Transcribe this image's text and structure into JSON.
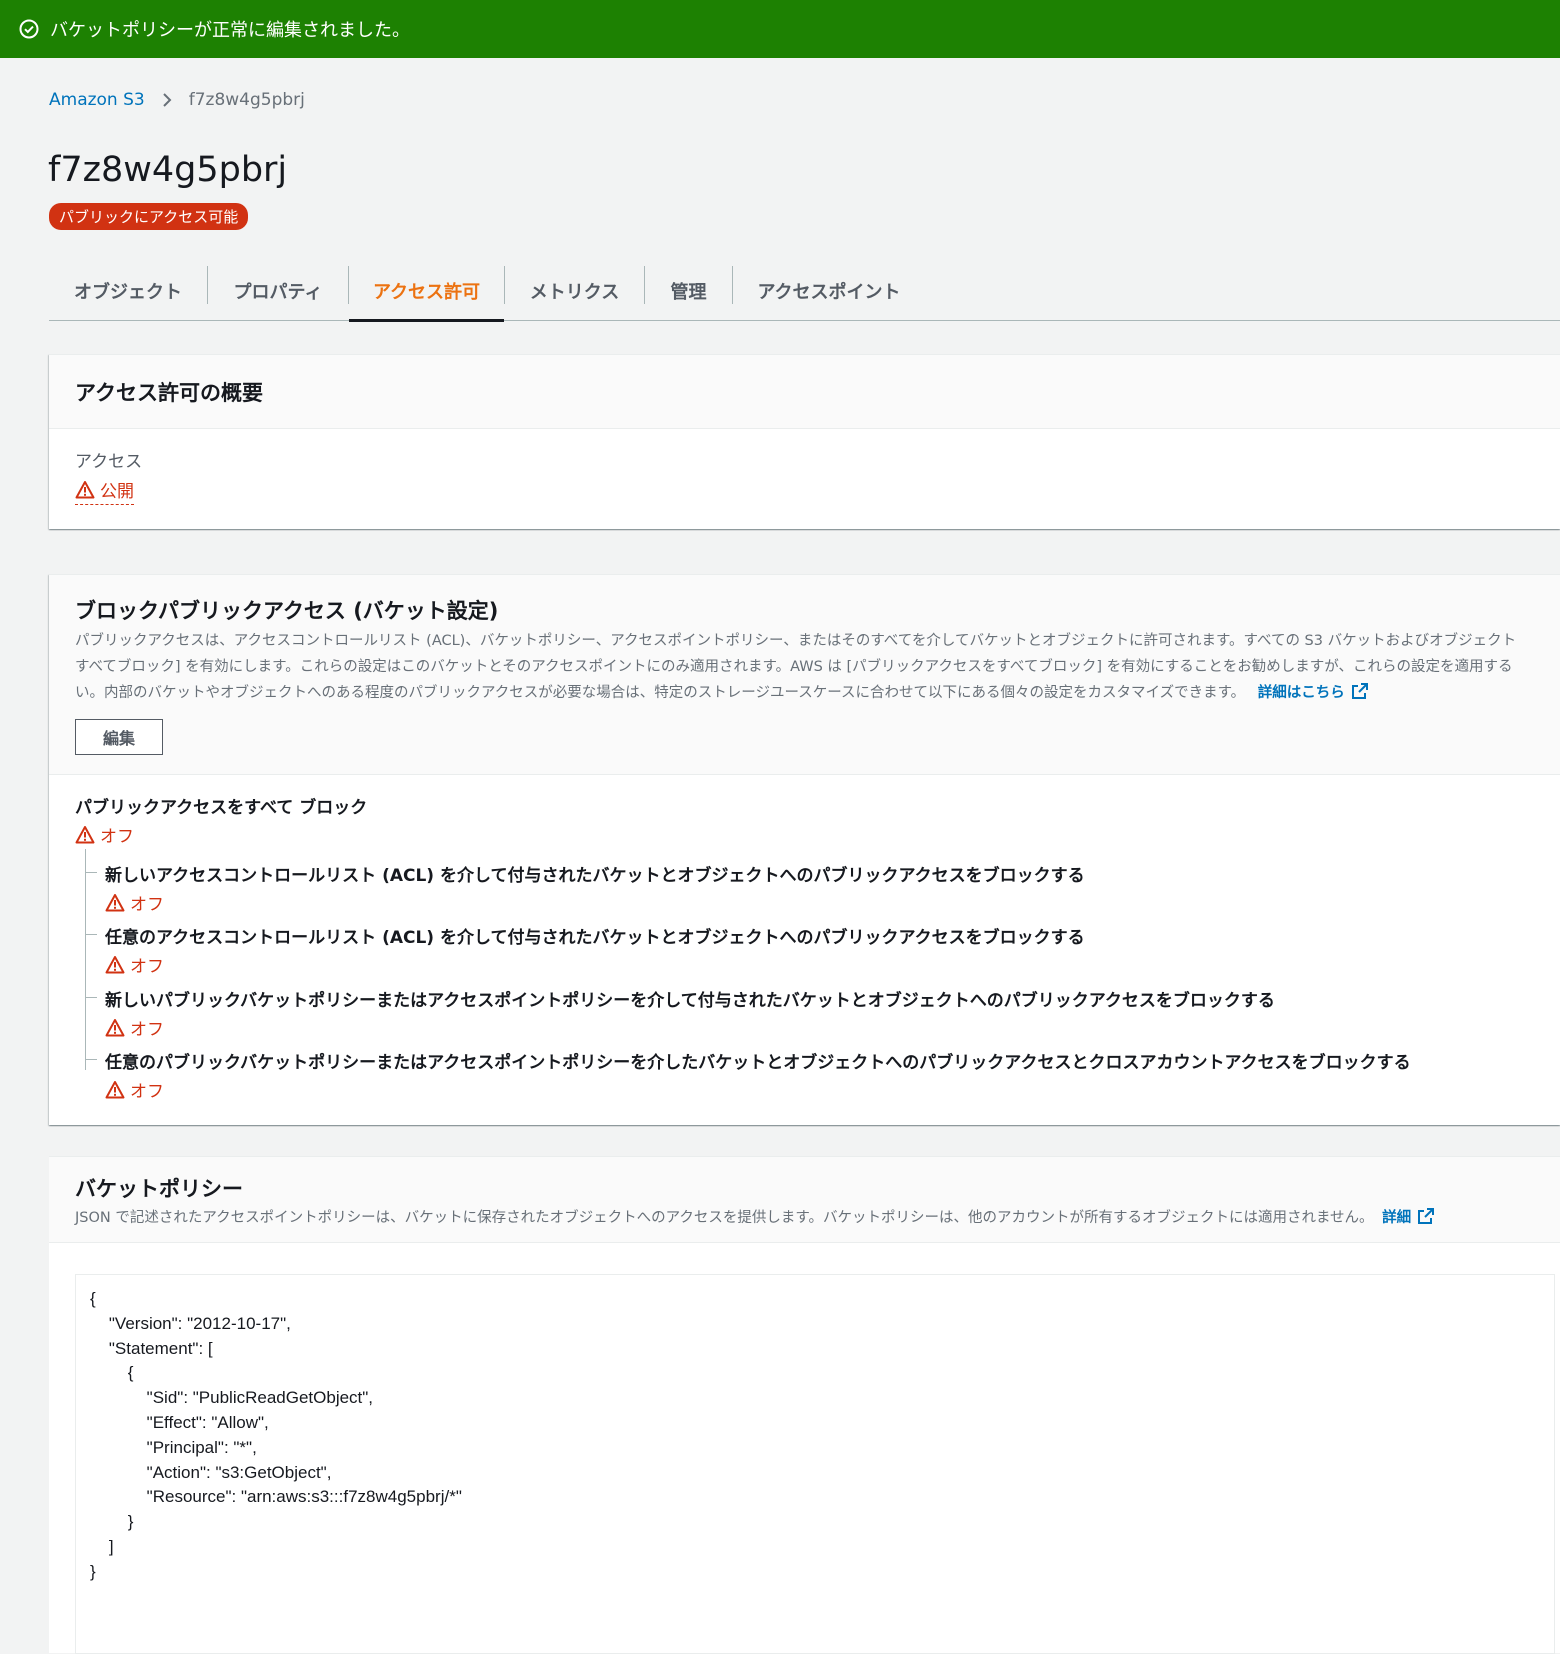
{
  "flash": {
    "message": "バケットポリシーが正常に編集されました。",
    "icon": "check-circle-icon"
  },
  "breadcrumb": {
    "root": "Amazon S3",
    "current": "f7z8w4g5pbrj"
  },
  "bucket": {
    "name": "f7z8w4g5pbrj",
    "badge": "パブリックにアクセス可能"
  },
  "tabs": [
    {
      "label": "オブジェクト"
    },
    {
      "label": "プロパティ"
    },
    {
      "label": "アクセス許可",
      "active": true
    },
    {
      "label": "メトリクス"
    },
    {
      "label": "管理"
    },
    {
      "label": "アクセスポイント"
    }
  ],
  "overview": {
    "title": "アクセス許可の概要",
    "access_label": "アクセス",
    "access_value": "公開"
  },
  "block_public": {
    "title": "ブロックパブリックアクセス (バケット設定)",
    "desc_line1": "パブリックアクセスは、アクセスコントロールリスト (ACL)、バケットポリシー、アクセスポイントポリシー、またはそのすべてを介してバケットとオブジェクトに許可されます。すべての S3 バケットおよびオブジェクト",
    "desc_line2": "すべてブロック] を有効にします。これらの設定はこのバケットとそのアクセスポイントにのみ適用されます。AWS は [パブリックアクセスをすべてブロック] を有効にすることをお勧めしますが、これらの設定を適用する",
    "desc_line3": "い。内部のバケットやオブジェクトへのある程度のパブリックアクセスが必要な場合は、特定のストレージユースケースに合わせて以下にある個々の設定をカスタマイズできます。",
    "learn_more": "詳細はこちら",
    "edit_label": "編集",
    "main_setting": {
      "label": "パブリックアクセスをすべて ブロック",
      "status": "オフ"
    },
    "sub_settings": [
      {
        "label": "新しいアクセスコントロールリスト (ACL) を介して付与されたバケットとオブジェクトへのパブリックアクセスをブロックする",
        "status": "オフ"
      },
      {
        "label": "任意のアクセスコントロールリスト (ACL) を介して付与されたバケットとオブジェクトへのパブリックアクセスをブロックする",
        "status": "オフ"
      },
      {
        "label": "新しいパブリックバケットポリシーまたはアクセスポイントポリシーを介して付与されたバケットとオブジェクトへのパブリックアクセスをブロックする",
        "status": "オフ"
      },
      {
        "label": "任意のパブリックバケットポリシーまたはアクセスポイントポリシーを介したバケットとオブジェクトへのパブリックアクセスとクロスアカウントアクセスをブロックする",
        "status": "オフ"
      }
    ]
  },
  "bucket_policy": {
    "title": "バケットポリシー",
    "desc": "JSON で記述されたアクセスポイントポリシーは、バケットに保存されたオブジェクトへのアクセスを提供します。バケットポリシーは、他のアカウントが所有するオブジェクトには適用されません。",
    "learn_more": "詳細",
    "code": "{\n    \"Version\": \"2012-10-17\",\n    \"Statement\": [\n        {\n            \"Sid\": \"PublicReadGetObject\",\n            \"Effect\": \"Allow\",\n            \"Principal\": \"*\",\n            \"Action\": \"s3:GetObject\",\n            \"Resource\": \"arn:aws:s3:::f7z8w4g5pbrj/*\"\n        }\n    ]\n}"
  },
  "colors": {
    "success": "#1d8102",
    "danger": "#d13212",
    "accent": "#ec7211",
    "link": "#0073bb"
  }
}
